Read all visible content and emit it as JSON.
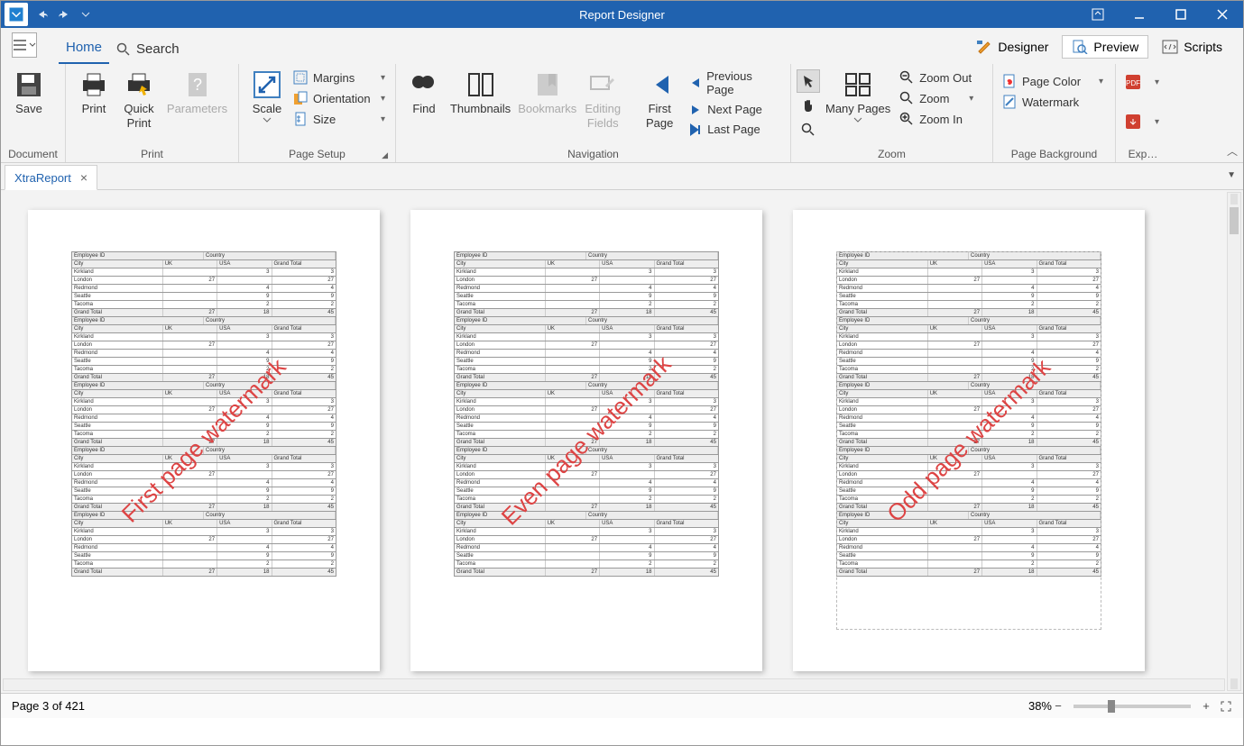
{
  "title": "Report Designer",
  "menu": {
    "home": "Home",
    "search": "Search"
  },
  "viewBtns": {
    "designer": "Designer",
    "preview": "Preview",
    "scripts": "Scripts"
  },
  "ribbon": {
    "document": {
      "label": "Document",
      "save": "Save"
    },
    "print": {
      "label": "Print",
      "print": "Print",
      "quick": "Quick\nPrint",
      "params": "Parameters"
    },
    "pageSetup": {
      "label": "Page Setup",
      "scale": "Scale",
      "margins": "Margins",
      "orientation": "Orientation",
      "size": "Size"
    },
    "navigation": {
      "label": "Navigation",
      "find": "Find",
      "thumb": "Thumbnails",
      "bookmarks": "Bookmarks",
      "editing": "Editing\nFields",
      "first": "First\nPage",
      "prev": "Previous Page",
      "next": "Next  Page",
      "last": "Last  Page"
    },
    "zoom": {
      "label": "Zoom",
      "many": "Many Pages",
      "out": "Zoom Out",
      "zoom": "Zoom",
      "in": "Zoom In"
    },
    "pageBg": {
      "label": "Page Background",
      "color": "Page Color",
      "watermark": "Watermark"
    },
    "export": {
      "label": "Exp…"
    }
  },
  "docTab": "XtraReport",
  "watermarks": [
    "First page watermark",
    "Even page watermark",
    "Odd page watermark"
  ],
  "tableHeaders": {
    "emp": "Employee ID",
    "country": "Country",
    "city": "City",
    "uk": "UK",
    "usa": "USA",
    "gt": "Grand Total"
  },
  "tableRows": [
    {
      "c": "Kirkland",
      "uk": "",
      "usa": "3",
      "gt": "3"
    },
    {
      "c": "London",
      "uk": "27",
      "usa": "",
      "gt": "27"
    },
    {
      "c": "Redmond",
      "uk": "",
      "usa": "4",
      "gt": "4"
    },
    {
      "c": "Seattle",
      "uk": "",
      "usa": "9",
      "gt": "9"
    },
    {
      "c": "Tacoma",
      "uk": "",
      "usa": "2",
      "gt": "2"
    },
    {
      "c": "Grand Total",
      "uk": "27",
      "usa": "18",
      "gt": "45"
    }
  ],
  "status": {
    "page": "Page 3 of 421",
    "zoom": "38%"
  }
}
